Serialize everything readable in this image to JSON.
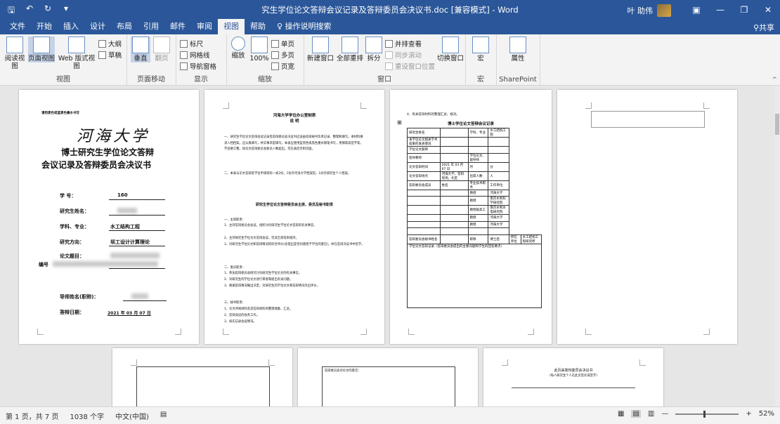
{
  "window": {
    "title": "究生学位论文答辩会议记录及答辩委员会决议书.doc [兼容模式] - Word",
    "user_name": "叶 助伟",
    "qat_icons": [
      "save-icon",
      "undo-icon",
      "redo-icon",
      "customize-icon"
    ]
  },
  "tabs": [
    "文件",
    "开始",
    "插入",
    "设计",
    "布局",
    "引用",
    "邮件",
    "审阅",
    "视图",
    "帮助",
    "操作说明搜索"
  ],
  "active_tab": "视图",
  "share_label": "共享",
  "ribbon": {
    "views": {
      "label": "视图",
      "read_mode": "阅读视图",
      "print_layout": "页面视图",
      "web_layout": "Web 版式视图",
      "outline": "大纲",
      "draft": "草稿"
    },
    "page_movement": {
      "label": "页面移动",
      "vertical": "垂直",
      "side": "翻页"
    },
    "show": {
      "label": "显示",
      "ruler": "标尺",
      "gridlines": "网格线",
      "nav_pane": "导航窗格"
    },
    "zoom": {
      "label": "缩放",
      "zoom": "缩放",
      "hundred": "100%",
      "one_page": "单页",
      "multi_page": "多页",
      "page_width": "页宽"
    },
    "window": {
      "label": "窗口",
      "new_window": "新建窗口",
      "arrange_all": "全部重排",
      "split": "拆分",
      "side_by_side": "并排查看",
      "sync_scroll": "同步滚动",
      "reset_pos": "重设窗口位置",
      "switch": "切换窗口"
    },
    "macros": {
      "label": "宏",
      "macros": "宏"
    },
    "sharepoint": {
      "label": "SharePoint",
      "properties": "属性"
    }
  },
  "pages": {
    "p1": {
      "header": "请用黑色或蓝黑色墨水书写",
      "univ": "河海大学",
      "title1": "博士研究生学位论文答辩",
      "title2": "会议记录及答辩委员会决议书",
      "student_id_label": "学 号：",
      "student_id_value": "160",
      "name_label": "研究生姓名：",
      "major_label": "学科、专业：",
      "major_value": "水工结构工程",
      "direction_label": "研究方向：",
      "direction_value": "坝工设计计算理论",
      "thesis_label": "论文题目：",
      "cover_label": "编号",
      "advisor_label": "导师姓名(职称)：",
      "defense_label": "答辩日期：",
      "defense_date": "2021 年 03 月 07 日"
    },
    "p2": {
      "office": "河海大学学位办公室制表",
      "heading": "说 明",
      "para1": "一、研究生学位论文答辩会议记录及答辩委员会决议书应该由答辩秘书负责记录、整理和填写。本材料要求入档档案，应认真填写，并实事求是填写。本表应使用蓝黑色或黑色墨水钢笔书写，用钢笔或签字笔，字迹要工整。如论文答辩委员会委员人数超出，可在表后另附页面。",
      "para2": "二、本表与论文答辩及学位申请资料一式2份，1份存河海大学档案馆，1份存研究生个人档案。",
      "sub_heading": "研究生学位论文答辩委员会主席、委员及秘书职责",
      "s1": "一、主席职责：",
      "s1a": "1、主持答辩委员会会议，组织讨论研究生学位论文答辩的有关事宜。",
      "s1b": "2、主持研究生学位论文答辩会议，完成全部答辩程序。",
      "s1c": "3、对研究生学位论文和答辩情况的综合评价(含提出是否同意授予学位的意见)，并在答辩决议书中签字。",
      "s2": "二、委员职责：",
      "s2a": "1、参加答辩委员会研究讨论研究生学位论文的有关事宜。",
      "s2b": "2、对研究生的学位论文进行审查和提出有关问题。",
      "s2c": "3、根据答辩情况做出决定，对研究生的学位论文和答辩情况作出评价。",
      "s3": "三、秘书职责：",
      "s3a": "1、论文评阅材料及其答辩材料的整理收集、汇总。",
      "s3b": "2、答辩会议的会务工作。",
      "s3c": "3、如实记录会议情况。"
    },
    "p3": {
      "note": "4、有关答辩材料的整理汇总、核对。",
      "heading": "博士学位论文答辩会议记录",
      "rows": [
        [
          "研究生姓名",
          "",
          "学科、专业",
          "水工结构工程"
        ],
        [
          "本学位论文相关学术成果的发表情况",
          "",
          "",
          ""
        ],
        [
          "学位论文题目",
          "",
          "",
          ""
        ],
        [
          "指导教师",
          "",
          "学位论文、副导师",
          ""
        ],
        [
          "论文答辩时间",
          "2021 年 03 月 07 日",
          "时",
          "分"
        ],
        [
          "论文答辩地点",
          "河海大学，答辩现场，北区",
          "出席人数",
          "人"
        ],
        [
          "答辩委员会成员",
          "姓名",
          "专业技术职务",
          "工作单位"
        ],
        [
          "",
          "",
          "教授",
          "河海大学"
        ],
        [
          "",
          "",
          "教授",
          "南京水利科学研究院"
        ],
        [
          "",
          "",
          "教授级高工",
          "南京水利水电研究院"
        ],
        [
          "",
          "",
          "教授",
          "河海大学"
        ],
        [
          "",
          "",
          "教授",
          "河海大学"
        ],
        [
          "",
          "",
          "",
          ""
        ],
        [
          "答辩委员会秘书姓名",
          "",
          "职称",
          "博士后",
          "所在单位",
          "水工结构工程研究所"
        ]
      ],
      "footer_row": "学位论文答辩记录（答辩委员会提出的主要问题和学生的回答要点）"
    },
    "p5": {
      "label": "答辩委员会对论文的意见："
    },
    "p7": {
      "heading": "此页由答辩委员会决议书",
      "sub": "(每人研究生个人在此页签名或签字)"
    }
  },
  "status": {
    "page": "第 1 页，共 7 页",
    "words": "1038 个字",
    "lang": "中文(中国)",
    "zoom": "52%"
  }
}
